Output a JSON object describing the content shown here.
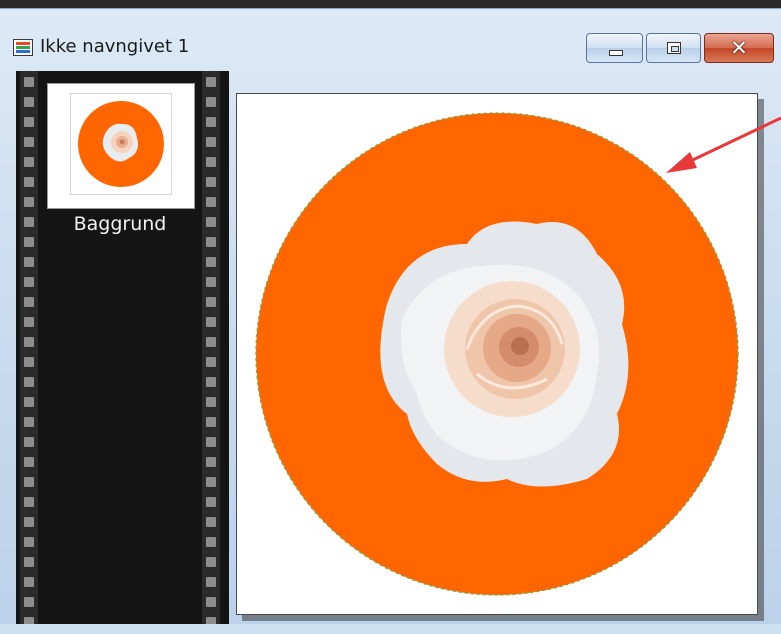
{
  "window": {
    "title": "Ikke navngivet 1",
    "controls": {
      "close_glyph": "✕"
    }
  },
  "layers": [
    {
      "name": "Baggrund"
    }
  ],
  "canvas": {
    "background": "#ffffff",
    "shape_color": "#ff6600",
    "selection_outline_color": "#7ca64a"
  },
  "annotation": {
    "arrow_color": "#e8393a"
  },
  "colors": {
    "filmstrip": "#141414",
    "titlebar": "#c6d9ee",
    "close_button": "#c24527"
  },
  "icons": [
    "app-icon",
    "minimize-icon",
    "maximize-icon",
    "close-icon",
    "rose-image"
  ]
}
